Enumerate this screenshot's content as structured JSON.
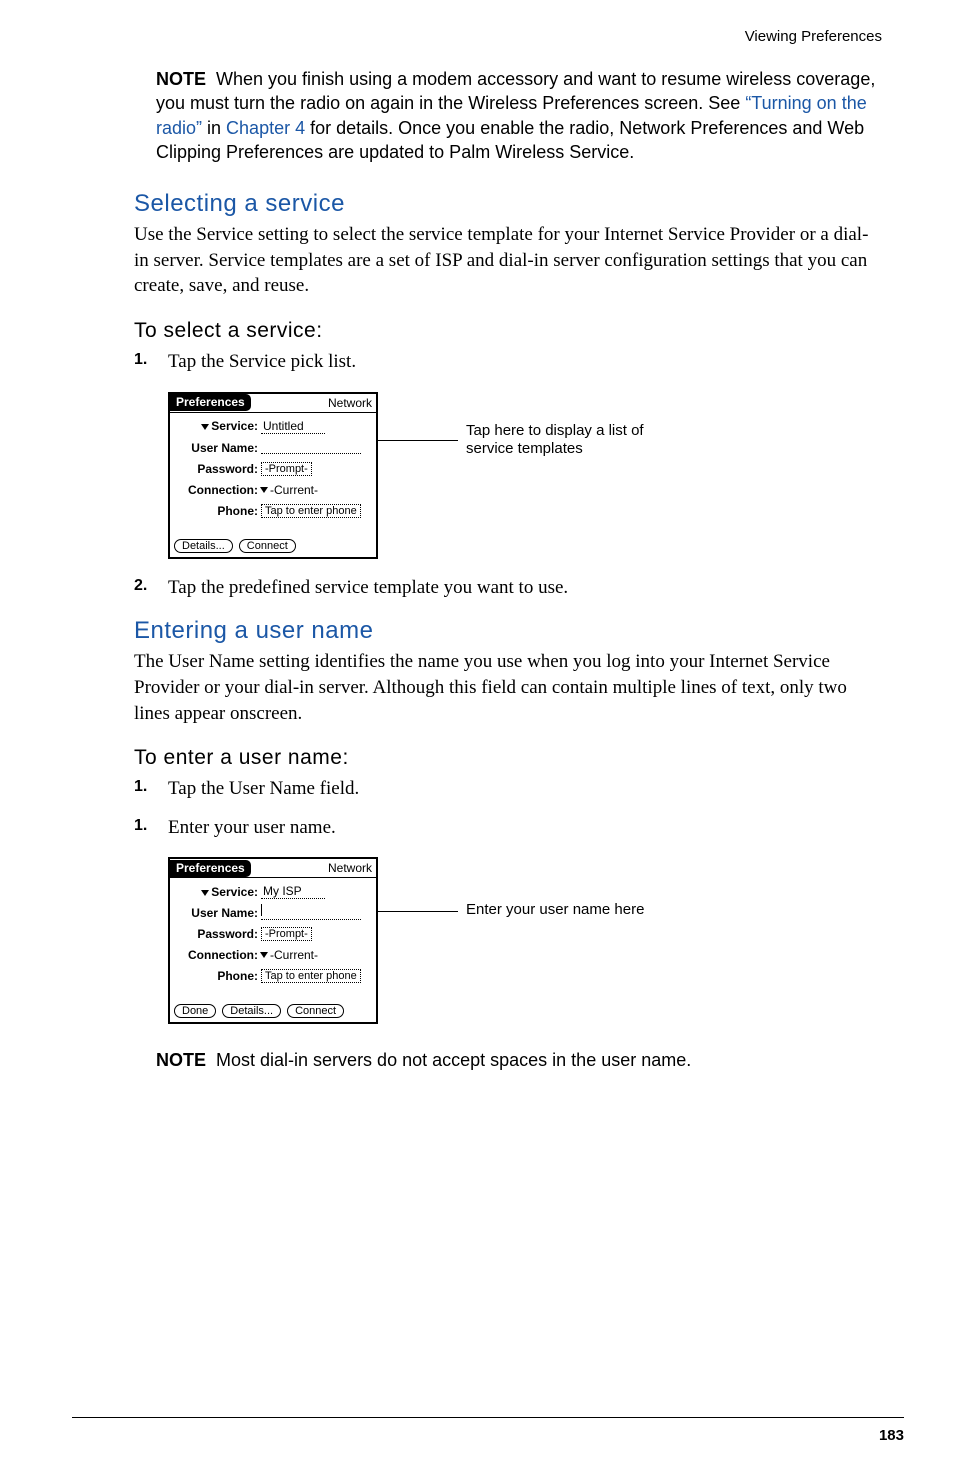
{
  "runningHead": "Viewing Preferences",
  "note1": {
    "label": "NOTE",
    "textA": "When you finish using a modem accessory and want to resume wireless coverage, you must turn the radio on again in the Wireless Preferences screen. See ",
    "link1": "“Turning on the radio”",
    "textB": " in ",
    "link2": "Chapter 4",
    "textC": " for details. Once you enable the radio, Network Preferences and Web Clipping Preferences are updated to Palm Wireless Service."
  },
  "sec1": {
    "heading": "Selecting a service",
    "para": "Use the Service setting to select the service template for your Internet Service Provider or a dial-in server. Service templates are a set of ISP and dial-in server configuration settings that you can create, save, and reuse.",
    "task": "To select a service:",
    "step1": "Tap the Service pick list.",
    "step2": "Tap the predefined service template you want to use."
  },
  "screen1": {
    "title": "Preferences",
    "menu": "Network",
    "labels": {
      "service": "Service:",
      "username": "User Name:",
      "password": "Password:",
      "connection": "Connection:",
      "phone": "Phone:"
    },
    "vals": {
      "service": "Untitled",
      "username": "",
      "password": "-Prompt-",
      "connection": "-Current-",
      "phone": "Tap to enter phone"
    },
    "buttons": {
      "details": "Details...",
      "connect": "Connect"
    },
    "callout": "Tap here to display a list of service templates"
  },
  "sec2": {
    "heading": "Entering a user name",
    "para": "The User Name setting identifies the name you use when you log into your Internet Service Provider or your dial-in server. Although this field can contain multiple lines of text, only two lines appear onscreen.",
    "task": "To enter a user name:",
    "step1": "Tap the User Name field.",
    "step2": "Enter your user name."
  },
  "screen2": {
    "title": "Preferences",
    "menu": "Network",
    "labels": {
      "service": "Service:",
      "username": "User Name:",
      "password": "Password:",
      "connection": "Connection:",
      "phone": "Phone:"
    },
    "vals": {
      "service": "My ISP",
      "username": "",
      "password": "-Prompt-",
      "connection": "-Current-",
      "phone": "Tap to enter phone"
    },
    "buttons": {
      "done": "Done",
      "details": "Details...",
      "connect": "Connect"
    },
    "callout": "Enter your user name here"
  },
  "note2": {
    "label": "NOTE",
    "text": "Most dial-in servers do not accept spaces in the user name."
  },
  "pageNum": "183",
  "stepNums": {
    "one": "1.",
    "two": "2."
  }
}
